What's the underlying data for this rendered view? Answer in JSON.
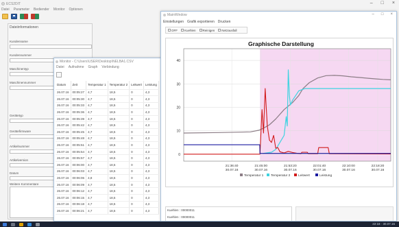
{
  "app": {
    "title": "ECS2DIT",
    "menu": [
      "Datei",
      "Parameter",
      "Bediender",
      "Monitor",
      "Optionen"
    ],
    "window_controls": [
      "–",
      "□",
      "×"
    ]
  },
  "sidebar": {
    "header": "Dateiinformationen",
    "fields": [
      "Kundenname",
      "Kundennummer",
      "Maschinentyp",
      "Maschinennummer",
      "Gerätetyp",
      "Gerätefirmware",
      "Artikelnummer",
      "Artikelversion",
      "Datum",
      "Weitere Kommentare"
    ]
  },
  "monitor": {
    "title": "Monitor - C:\\Users\\USER\\Desktop\\NELBA1.CSV",
    "menu": [
      "Datei",
      "Aufnahme",
      "Graph",
      "Verbindung"
    ],
    "columns": [
      "Datum",
      "Zeit",
      "Temperatur 1",
      "Temperatur 2",
      "Leitwert",
      "Leistung"
    ],
    "rows": [
      [
        "26.07.16",
        "00:05:27",
        "4,7",
        "18,5",
        "0",
        "4,3"
      ],
      [
        "26.07.16",
        "00:05:30",
        "4,7",
        "18,5",
        "0",
        "4,3"
      ],
      [
        "26.07.16",
        "00:05:33",
        "4,7",
        "18,5",
        "0",
        "4,3"
      ],
      [
        "26.07.16",
        "00:05:36",
        "4,7",
        "18,5",
        "0",
        "4,3"
      ],
      [
        "26.07.16",
        "00:05:39",
        "4,7",
        "18,5",
        "0",
        "4,3"
      ],
      [
        "26.07.16",
        "00:05:42",
        "4,7",
        "18,5",
        "0",
        "4,3"
      ],
      [
        "26.07.16",
        "00:05:45",
        "4,7",
        "18,5",
        "0",
        "4,3"
      ],
      [
        "26.07.16",
        "00:05:48",
        "4,7",
        "18,5",
        "0",
        "4,3"
      ],
      [
        "26.07.16",
        "00:05:51",
        "4,7",
        "18,5",
        "0",
        "4,3"
      ],
      [
        "26.07.16",
        "00:05:54",
        "4,7",
        "18,5",
        "0",
        "4,3"
      ],
      [
        "26.07.16",
        "00:05:57",
        "4,7",
        "18,5",
        "0",
        "4,3"
      ],
      [
        "26.07.16",
        "00:06:00",
        "4,7",
        "18,5",
        "0",
        "4,3"
      ],
      [
        "26.07.16",
        "00:06:03",
        "4,7",
        "18,5",
        "0",
        "4,3"
      ],
      [
        "26.07.16",
        "00:06:06",
        "4,8",
        "18,5",
        "0",
        "4,3"
      ],
      [
        "26.07.16",
        "00:06:09",
        "4,7",
        "18,5",
        "0",
        "4,3"
      ],
      [
        "26.07.16",
        "00:06:12",
        "4,7",
        "18,5",
        "0",
        "4,3"
      ],
      [
        "26.07.16",
        "00:06:15",
        "4,7",
        "18,5",
        "0",
        "4,3"
      ],
      [
        "26.07.16",
        "00:06:18",
        "4,7",
        "18,5",
        "0",
        "4,3"
      ],
      [
        "26.07.16",
        "00:06:21",
        "4,7",
        "18,5",
        "0",
        "4,3"
      ]
    ]
  },
  "mainwindow": {
    "title": "MainWindow",
    "menu": [
      "Einstellungen",
      "Grafik exportieren",
      "Drucken"
    ],
    "modes": [
      "OFF",
      "Kuehlen",
      "Reinigen",
      "Netzausfall"
    ],
    "console_lines": [
      "Kuehlen : 00000011",
      "Kuehlen : 00000011"
    ]
  },
  "colors": {
    "temperatur1": "#8c7d86",
    "temperatur2": "#3fd3e0",
    "leitwert": "#d11a1a",
    "leistung": "#1a1aa0",
    "highlight_region": "#f6d8f2"
  },
  "chart_data": {
    "type": "line",
    "title": "Graphische Darstellung",
    "xlabel": "",
    "ylabel": "",
    "ylim": [
      -3,
      45
    ],
    "yticks": [
      0,
      10,
      20,
      30,
      40
    ],
    "xticks": [
      {
        "time": "21:36:40",
        "date": "30.07.16",
        "t": 21.611
      },
      {
        "time": "21:45:00",
        "date": "30.07.16",
        "t": 21.75
      },
      {
        "time": "21:53:20",
        "date": "30.07.16",
        "t": 21.889
      },
      {
        "time": "22:01:40",
        "date": "30.07.16",
        "t": 22.028
      },
      {
        "time": "22:10:00",
        "date": "30.07.16",
        "t": 22.167
      },
      {
        "time": "22:18:20",
        "date": "30.07.16",
        "t": 22.306
      }
    ],
    "xlim": [
      21.382,
      22.368
    ],
    "highlight_from": 21.745,
    "series": [
      {
        "name": "Temperatur 1",
        "color": "#8c7d86",
        "x": [
          21.382,
          21.55,
          21.7,
          21.74,
          21.76,
          21.79,
          21.82,
          21.86,
          21.9,
          21.93,
          21.95,
          21.98,
          22.02,
          22.06,
          22.1,
          22.14,
          22.18,
          22.22,
          22.26,
          22.3,
          22.33,
          22.368
        ],
        "y": [
          9.0,
          9.2,
          9.5,
          10.2,
          11.0,
          12.5,
          15.0,
          19.0,
          22.0,
          25.0,
          28.0,
          30.5,
          32.5,
          33.5,
          33.6,
          33.4,
          33.0,
          32.7,
          32.4,
          32.1,
          31.9,
          31.7
        ]
      },
      {
        "name": "Temperatur 2",
        "color": "#3fd3e0",
        "x": [
          21.76,
          21.8,
          21.82,
          21.86,
          21.87,
          21.875,
          21.88,
          21.885,
          21.89,
          21.9,
          21.93,
          21.96,
          21.99,
          22.03,
          22.07,
          22.1,
          22.14,
          22.18,
          22.22,
          22.26,
          22.3,
          22.34,
          22.368
        ],
        "y": [
          0.3,
          0.8,
          2.0,
          8.0,
          16.0,
          12.0,
          36.0,
          25.0,
          21.0,
          23.0,
          27.0,
          28.0,
          28.0,
          28.0,
          28.0,
          28.0,
          28.0,
          28.0,
          28.0,
          28.0,
          28.0,
          28.0,
          28.0
        ]
      },
      {
        "name": "Leitwert",
        "color": "#d11a1a",
        "x": [
          21.382,
          21.745,
          21.755,
          21.762,
          21.77,
          21.78,
          21.79,
          21.8,
          21.81,
          21.82,
          21.83,
          21.84,
          21.86,
          21.88,
          21.9,
          21.92,
          21.94,
          21.945,
          21.96,
          21.97,
          21.975,
          22.02,
          22.025,
          22.04,
          22.06,
          22.07,
          22.075,
          22.368
        ],
        "y": [
          0.0,
          0.0,
          19.0,
          9.0,
          28.0,
          12.0,
          6.0,
          5.0,
          8.0,
          2.5,
          2.8,
          1.0,
          0.5,
          1.2,
          0.7,
          0.4,
          0.2,
          0.8,
          0.8,
          0.8,
          0.2,
          0.2,
          2.8,
          2.8,
          2.8,
          2.8,
          0.2,
          0.1
        ]
      },
      {
        "name": "Leistung",
        "color": "#1a1aa0",
        "x": [
          21.382,
          21.744,
          21.745,
          22.368
        ],
        "y": [
          4.0,
          4.0,
          0.3,
          0.3
        ]
      }
    ]
  },
  "taskbar": {
    "tray_text": "22:18 · 30.07.16"
  }
}
